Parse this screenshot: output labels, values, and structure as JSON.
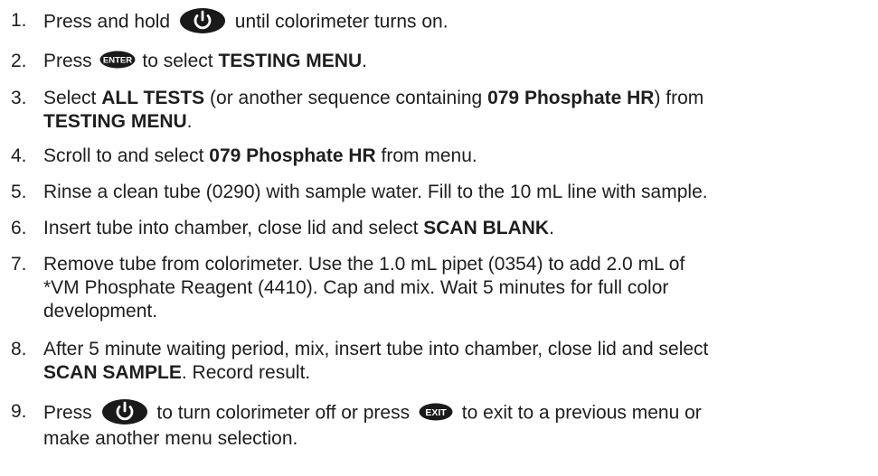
{
  "steps": [
    {
      "num": "1.",
      "a": "Press and hold",
      "b": "until colorimeter turns on."
    },
    {
      "num": "2.",
      "a": "Press",
      "b": "to select",
      "c": "TESTING MENU",
      "d": "."
    },
    {
      "num": "3.",
      "a": "Select",
      "b": "ALL TESTS",
      "c": "(or another sequence containing",
      "d": "079 Phosphate HR",
      "e": ") from",
      "f": "TESTING MENU",
      "g": "."
    },
    {
      "num": "4.",
      "a": "Scroll to and select",
      "b": "079 Phosphate HR",
      "c": "from menu."
    },
    {
      "num": "5.",
      "a": "Rinse a clean tube (0290) with sample water. Fill to the 10 mL line with sample."
    },
    {
      "num": "6.",
      "a": "Insert tube into chamber, close lid and select",
      "b": "SCAN BLANK",
      "c": "."
    },
    {
      "num": "7.",
      "a": "Remove tube from colorimeter. Use the 1.0 mL pipet (0354) to add 2.0 mL of",
      "b": "*VM Phosphate Reagent (4410). Cap and mix. Wait 5 minutes for full color",
      "c": "development."
    },
    {
      "num": "8.",
      "a": "After 5 minute waiting period, mix, insert tube into chamber, close lid and select",
      "b": "SCAN SAMPLE",
      "c": ". Record result."
    },
    {
      "num": "9.",
      "a": "Press",
      "b": "to turn colorimeter off or press",
      "c": "to exit to a previous menu or",
      "d": "make another menu selection."
    }
  ],
  "icons": {
    "power": "power-button-icon",
    "enter": "enter-button-icon",
    "exit": "exit-button-icon",
    "enter_text": "ENTER",
    "exit_text": "EXIT"
  },
  "colors": {
    "text": "#1e1e1e",
    "button_fill": "#1a1a1a",
    "button_text": "#ffffff"
  }
}
